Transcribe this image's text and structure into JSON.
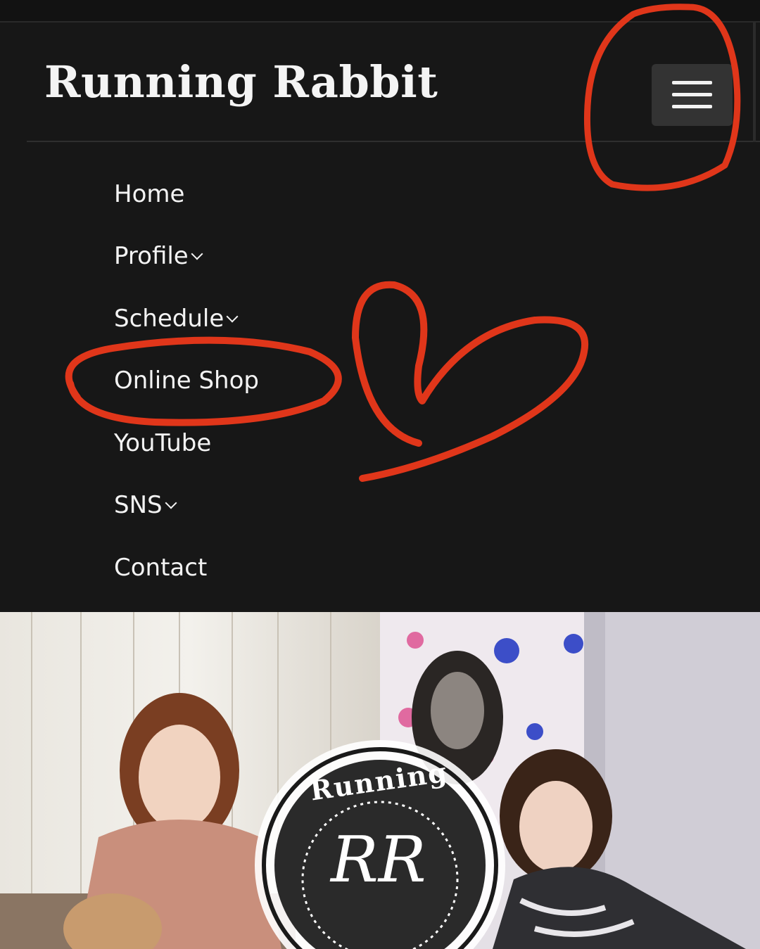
{
  "header": {
    "site_title": "Running Rabbit",
    "menu_icon": "hamburger-menu-icon"
  },
  "nav": {
    "items": [
      {
        "label": "Home",
        "has_dropdown": false
      },
      {
        "label": "Profile",
        "has_dropdown": true
      },
      {
        "label": "Schedule",
        "has_dropdown": true
      },
      {
        "label": "Online Shop",
        "has_dropdown": false
      },
      {
        "label": "YouTube",
        "has_dropdown": false
      },
      {
        "label": "SNS",
        "has_dropdown": true
      },
      {
        "label": "Contact",
        "has_dropdown": false
      }
    ]
  },
  "hero": {
    "logo_text": "Running",
    "logo_monogram": "RR"
  },
  "colors": {
    "background": "#171717",
    "text": "#f3f3f3",
    "annotation": "#e0361a",
    "menu_button": "#333333"
  }
}
